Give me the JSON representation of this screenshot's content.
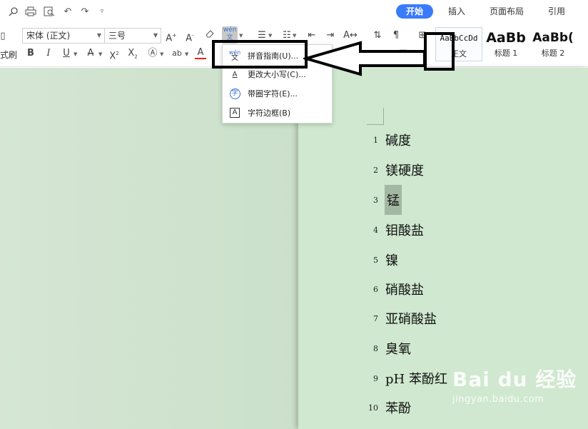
{
  "tabs": [
    {
      "label": "开始",
      "active": true
    },
    {
      "label": "插入",
      "active": false
    },
    {
      "label": "页面布局",
      "active": false
    },
    {
      "label": "引用",
      "active": false
    }
  ],
  "ribbon": {
    "font_name": "宋体 (正文)",
    "font_size": "三号",
    "left_cut_label": "式刷",
    "styles": [
      {
        "sample": "AaBbCcDd",
        "name": "正文"
      },
      {
        "sample": "AaBb",
        "name": "标题 1"
      },
      {
        "sample": "AaBb(",
        "name": "标题 2"
      }
    ]
  },
  "dropdown": {
    "items": [
      {
        "icon": "pinyin-guide-icon",
        "glyph": "wén",
        "label": "拼音指南(U)..."
      },
      {
        "icon": "change-case-icon",
        "glyph": "A",
        "label": "更改大小写(C)..."
      },
      {
        "icon": "enclosed-char-icon",
        "glyph": "字",
        "label": "带圈字符(E)..."
      },
      {
        "icon": "char-border-icon",
        "glyph": "A",
        "label": "字符边框(B)"
      }
    ]
  },
  "document": {
    "lines": [
      {
        "no": "1",
        "text": "碱度"
      },
      {
        "no": "2",
        "text": "镁硬度"
      },
      {
        "no": "3",
        "text": "锰",
        "highlighted": true
      },
      {
        "no": "4",
        "text": "钼酸盐"
      },
      {
        "no": "5",
        "text": "镍"
      },
      {
        "no": "6",
        "text": "硝酸盐"
      },
      {
        "no": "7",
        "text": "亚硝酸盐"
      },
      {
        "no": "8",
        "text": "臭氧"
      },
      {
        "no": "9",
        "text": "pH 苯酚红"
      },
      {
        "no": "10",
        "text": "苯酚"
      }
    ]
  },
  "watermark": {
    "main": "Bai du 经验",
    "sub": "jingyan.baidu.com"
  },
  "colors": {
    "accent": "#3a7bfb",
    "page": "#cfe8cf",
    "workspace": "#c9dfc8",
    "highlight": "#a3b7a2"
  }
}
